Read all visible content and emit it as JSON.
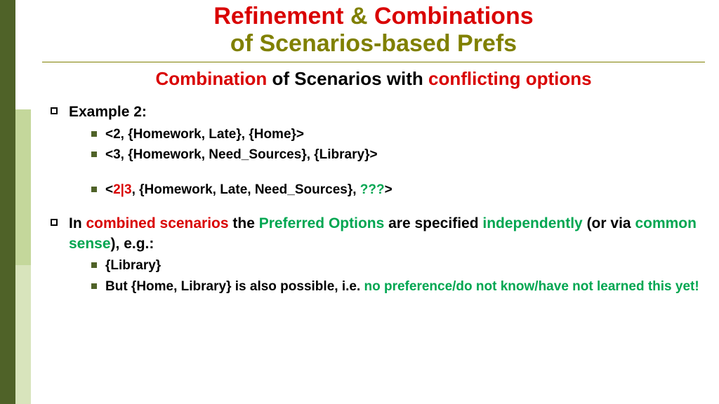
{
  "title": {
    "word1": "Refinement",
    "amp": "&",
    "word2": "Combinations",
    "line2": "of Scenarios-based Prefs"
  },
  "subhead": {
    "w1": "Combination",
    "w2": " of Scenarios with ",
    "w3": "conflicting options"
  },
  "example": {
    "label": "Example 2:",
    "tuple1": "<2, {Homework, Late}, {Home}>",
    "tuple2": "<3, {Homework, Need_Sources}, {Library}>",
    "combined": {
      "open": "<",
      "ids": "2|3",
      "mid": ", {Homework, Late, Need_Sources},  ",
      "q": "???",
      "close": ">"
    }
  },
  "in_line": {
    "p1": "In ",
    "p2": "combined scenarios",
    "p3": " the ",
    "p4": "Preferred Options",
    "p5": " are specified ",
    "p6": "independently",
    "p7": " (or via ",
    "p8": "common sense",
    "p9": "), e.g.:"
  },
  "notes": {
    "n1": "{Library}",
    "n2a": "But {Home, Library} is also possible, i.e. ",
    "n2b": "no preference/do not know/have not learned this yet!"
  }
}
